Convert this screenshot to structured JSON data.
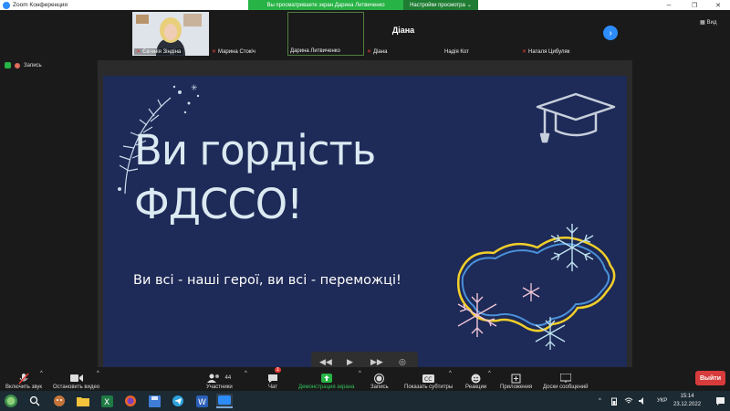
{
  "window": {
    "app_title": "Zoom Конференция",
    "share_banner": "Вы просматриваете экран Дарина Литвиченко",
    "view_options": "Настройки просмотра",
    "minimize": "–",
    "restore": "❐",
    "close": "✕"
  },
  "participants": {
    "tiles": [
      {
        "name": "Євгенія Зіндіна",
        "muted": true,
        "video": true
      },
      {
        "name": "Марина Стокіч",
        "muted": true,
        "video": false
      },
      {
        "name": "Дарина Литвиченко",
        "muted": false,
        "video": false,
        "speaking": true
      },
      {
        "name": "Діана",
        "big_label": "Діана",
        "muted": true,
        "video": false
      },
      {
        "name": "Надія Кот",
        "muted": false,
        "video": false
      },
      {
        "name": "Наталя Цибуляк",
        "muted": true,
        "video": false
      }
    ],
    "view_label": "Вид"
  },
  "recording": {
    "label": "Запись"
  },
  "slide": {
    "title_line1": "Ви гордість",
    "title_line2": "ФДССО!",
    "subtitle": "Ви всі - наші герої, ви всі - переможці!"
  },
  "toolbar": {
    "audio": "Включить звук",
    "video": "Остановить видео",
    "participants": "Участники",
    "participants_count": "44",
    "chat": "Чат",
    "chat_badge": "1",
    "share": "Демонстрация экрана",
    "record": "Запись",
    "captions": "Показать субтитры",
    "reactions": "Реакции",
    "apps": "Приложения",
    "whiteboards": "Доски сообщений",
    "leave": "Выйти"
  },
  "taskbar": {
    "language": "УКР",
    "time": "15:14",
    "date": "23.12.2022"
  },
  "colors": {
    "slide_bg": "#1e2a57",
    "share_green": "#27b345",
    "zoom_blue": "#2d8cff",
    "leave_red": "#d83b3b"
  }
}
